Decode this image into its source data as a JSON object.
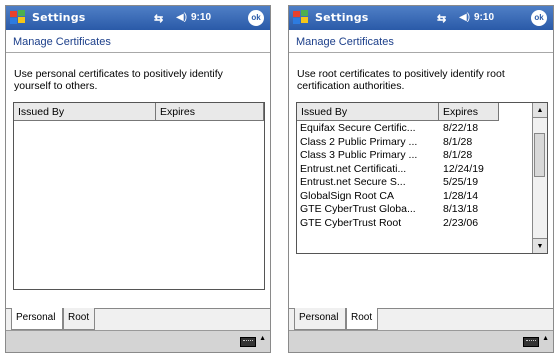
{
  "screens": [
    {
      "title": "Settings",
      "clock": "9:10",
      "ok_label": "ok",
      "heading": "Manage Certificates",
      "description": "Use personal certificates to positively identify yourself to others.",
      "columns": [
        "Issued By",
        "Expires"
      ],
      "rows": [],
      "tabs": [
        {
          "label": "Personal",
          "active": true
        },
        {
          "label": "Root",
          "active": false
        }
      ]
    },
    {
      "title": "Settings",
      "clock": "9:10",
      "ok_label": "ok",
      "heading": "Manage Certificates",
      "description": "Use root certificates to positively identify root certification authorities.",
      "columns": [
        "Issued By",
        "Expires"
      ],
      "rows": [
        {
          "issued_by": "Equifax Secure Certific...",
          "expires": "8/22/18"
        },
        {
          "issued_by": "Class 2 Public Primary ...",
          "expires": "8/1/28"
        },
        {
          "issued_by": "Class 3 Public Primary ...",
          "expires": "8/1/28"
        },
        {
          "issued_by": "Entrust.net Certificati...",
          "expires": "12/24/19"
        },
        {
          "issued_by": "Entrust.net Secure S...",
          "expires": "5/25/19"
        },
        {
          "issued_by": "GlobalSign Root CA",
          "expires": "1/28/14"
        },
        {
          "issued_by": "GTE CyberTrust Globa...",
          "expires": "8/13/18"
        },
        {
          "issued_by": "GTE CyberTrust Root",
          "expires": "2/23/06"
        }
      ],
      "tabs": [
        {
          "label": "Personal",
          "active": false
        },
        {
          "label": "Root",
          "active": true
        }
      ]
    }
  ],
  "icons": {
    "start": "windows-flag-icon",
    "connectivity": "connectivity-icon",
    "volume": "speaker-icon",
    "keyboard": "keyboard-icon"
  },
  "colors": {
    "titlebar": "#2a5aa8",
    "heading_text": "#1c3f8a"
  }
}
